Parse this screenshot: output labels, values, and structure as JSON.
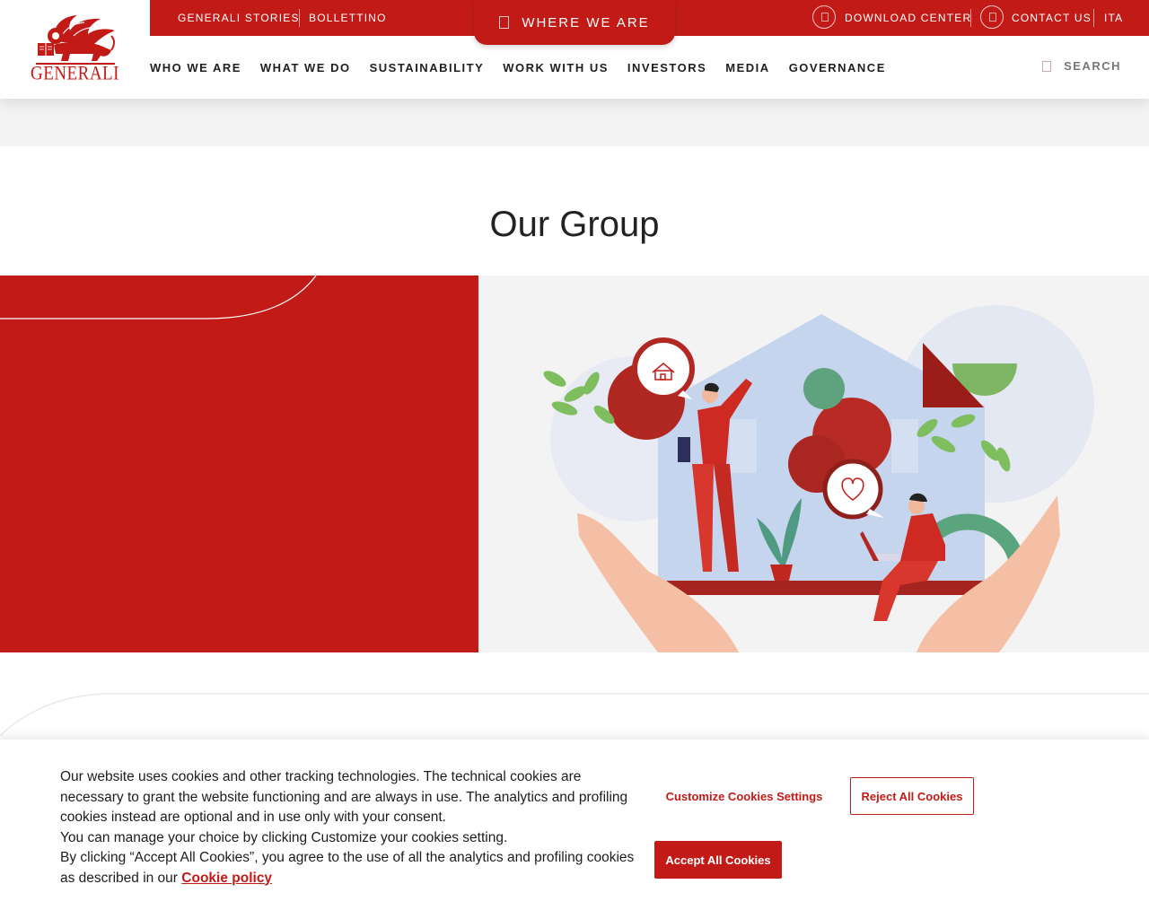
{
  "header": {
    "logo_text": "GENERALI",
    "top_links": {
      "stories": "GENERALI STORIES",
      "bollettino": "BOLLETTINO",
      "where_we_are": "WHERE WE ARE",
      "download_center": "DOWNLOAD CENTER",
      "contact_us": "CONTACT US",
      "language": "ITA"
    },
    "nav": [
      {
        "label": "WHO WE ARE"
      },
      {
        "label": "WHAT WE DO"
      },
      {
        "label": "SUSTAINABILITY"
      },
      {
        "label": "WORK WITH US"
      },
      {
        "label": "INVESTORS"
      },
      {
        "label": "MEDIA"
      },
      {
        "label": "GOVERNANCE"
      }
    ],
    "search_label": "SEARCH"
  },
  "main": {
    "title": "Our Group"
  },
  "cookie_banner": {
    "line1": "Our website uses cookies and other tracking technologies. The technical cookies are necessary to grant the website functioning and are always in use. The analytics and profiling cookies instead are optional and in use only with your consent.",
    "line2": "You can manage your choice by clicking Customize your cookies setting.",
    "line3": "By clicking “Accept All Cookies”, you agree to the use of all the analytics and profiling cookies as described in our",
    "policy_link": "Cookie policy",
    "customize_label": "Customize Cookies Settings",
    "reject_label": "Reject All Cookies",
    "accept_label": "Accept All Cookies"
  },
  "colors": {
    "brand_red": "#c21b17",
    "text_dark": "#1f1f1f",
    "band_grey": "#f4f4f4"
  },
  "icons": {
    "logo": "winged-lion-logo",
    "download": "download-icon",
    "contact": "contact-icon",
    "location": "location-pin-icon",
    "search": "search-icon",
    "home_bubble": "home-icon",
    "heart_bubble": "heart-icon"
  }
}
